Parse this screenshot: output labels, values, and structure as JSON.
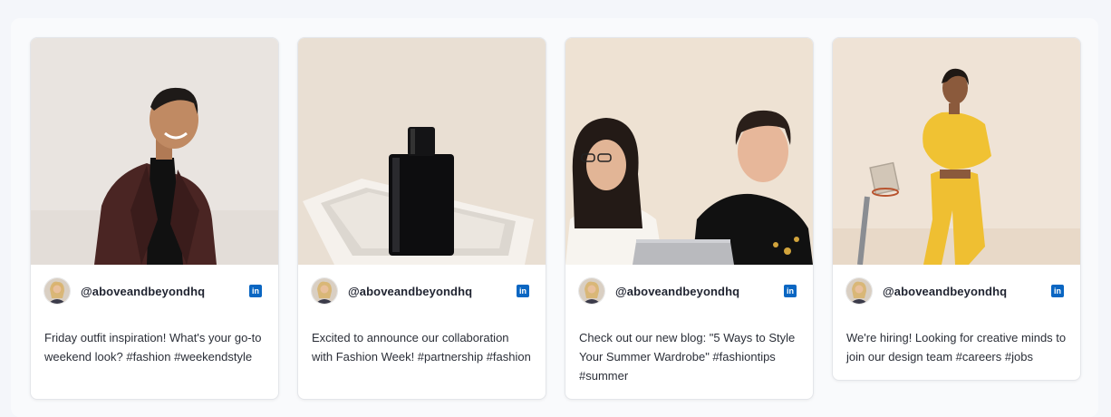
{
  "posts": [
    {
      "image": "man-in-suit-photo",
      "handle": "@aboveandbeyondhq",
      "network_icon": "linkedin-icon",
      "text": "Friday outfit inspiration! What's your go-to weekend look? #fashion #weekendstyle"
    },
    {
      "image": "perfume-bottle-photo",
      "handle": "@aboveandbeyondhq",
      "network_icon": "linkedin-icon",
      "text": "Excited to announce our collaboration with Fashion Week! #partnership #fashion"
    },
    {
      "image": "two-people-laptop-photo",
      "handle": "@aboveandbeyondhq",
      "network_icon": "linkedin-icon",
      "text": "Check out our new blog: \"5 Ways to Style Your Summer Wardrobe\" #fashiontips #summer"
    },
    {
      "image": "woman-yellow-outfit-photo",
      "handle": "@aboveandbeyondhq",
      "network_icon": "linkedin-icon",
      "text": "We're hiring! Looking for creative minds to join our design team #careers #jobs"
    }
  ],
  "colors": {
    "linkedin": "#0a66c2",
    "background": "#f4f6fa",
    "card": "#ffffff",
    "text": "#2b2f38"
  },
  "icons": {
    "network": "in"
  }
}
